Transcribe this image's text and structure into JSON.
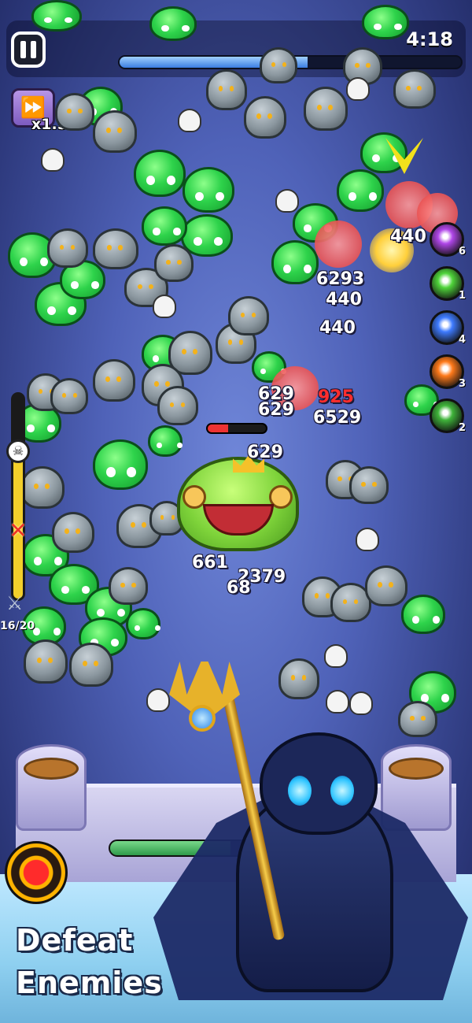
{
  "hud": {
    "timer": "4:18",
    "wave_progress": 0.55,
    "speed_label": "x1.5"
  },
  "wave": {
    "count_label": "16/20",
    "fill": 0.8
  },
  "skills": [
    {
      "name": "purple-slash-skill",
      "color": "#b046e8",
      "count": "6"
    },
    {
      "name": "green-claw-skill",
      "color": "#4fd43a",
      "count": "1"
    },
    {
      "name": "blue-bolt-skill",
      "color": "#3e7bff",
      "count": "4"
    },
    {
      "name": "fire-skill",
      "color": "#ff7a1a",
      "count": "3"
    },
    {
      "name": "green-wind-skill",
      "color": "#3fb33a",
      "count": "2"
    }
  ],
  "damage_numbers": [
    {
      "text": "440",
      "style": "white"
    },
    {
      "text": "6293",
      "style": "white"
    },
    {
      "text": "440",
      "style": "white"
    },
    {
      "text": "440",
      "style": "white"
    },
    {
      "text": "629",
      "style": "white"
    },
    {
      "text": "925",
      "style": "red"
    },
    {
      "text": "629",
      "style": "white"
    },
    {
      "text": "6529",
      "style": "white"
    },
    {
      "text": "629",
      "style": "white"
    },
    {
      "text": "661",
      "style": "white"
    },
    {
      "text": "2379",
      "style": "white"
    },
    {
      "text": "68",
      "style": "white"
    }
  ],
  "boss": {
    "hp": 0.35
  },
  "castle": {
    "hp": 0.78
  },
  "caption": {
    "line1": "Defeat",
    "line2": "Enemies"
  }
}
